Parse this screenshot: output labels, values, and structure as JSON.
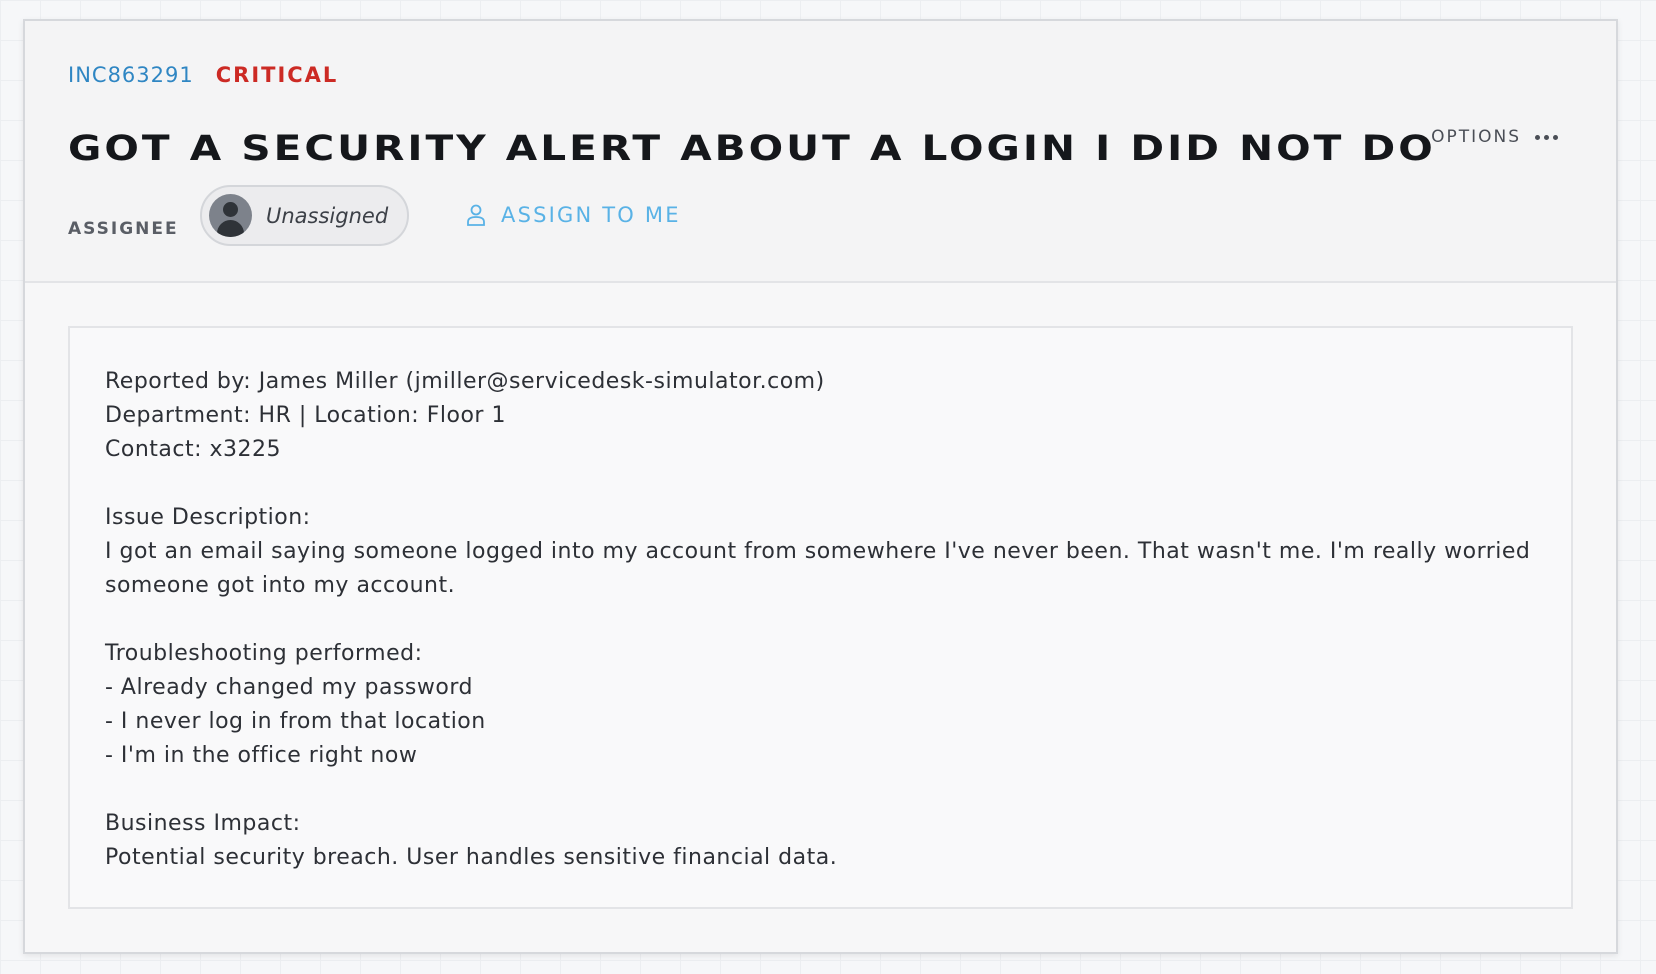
{
  "ticket": {
    "id": "INC863291",
    "priority": "CRITICAL",
    "title": "GOT A SECURITY ALERT ABOUT A LOGIN I DID NOT DO",
    "options_label": "OPTIONS"
  },
  "assignee": {
    "label": "ASSIGNEE",
    "name": "Unassigned",
    "assign_button": "ASSIGN TO ME"
  },
  "description": {
    "reported_by": "Reported by: James Miller (jmiller@servicedesk-simulator.com)",
    "department": "Department: HR | Location: Floor 1",
    "contact": "Contact: x3225",
    "issue_heading": "Issue Description:",
    "issue_text": "I got an email saying someone logged into my account from somewhere I've never been. That wasn't me. I'm really worried someone got into my account.",
    "troubleshooting_heading": "Troubleshooting performed:",
    "troubleshooting_items": [
      "- Already changed my password",
      "- I never log in from that location",
      "- I'm in the office right now"
    ],
    "impact_heading": "Business Impact:",
    "impact_text": "Potential security breach. User handles sensitive financial data."
  },
  "colors": {
    "ticket_id": "#2f86c3",
    "priority_critical": "#cc2a24",
    "assign_link": "#59b2e6"
  },
  "icons": {
    "avatar": "user-avatar-icon",
    "assign": "user-icon",
    "options": "more-horizontal-icon"
  }
}
